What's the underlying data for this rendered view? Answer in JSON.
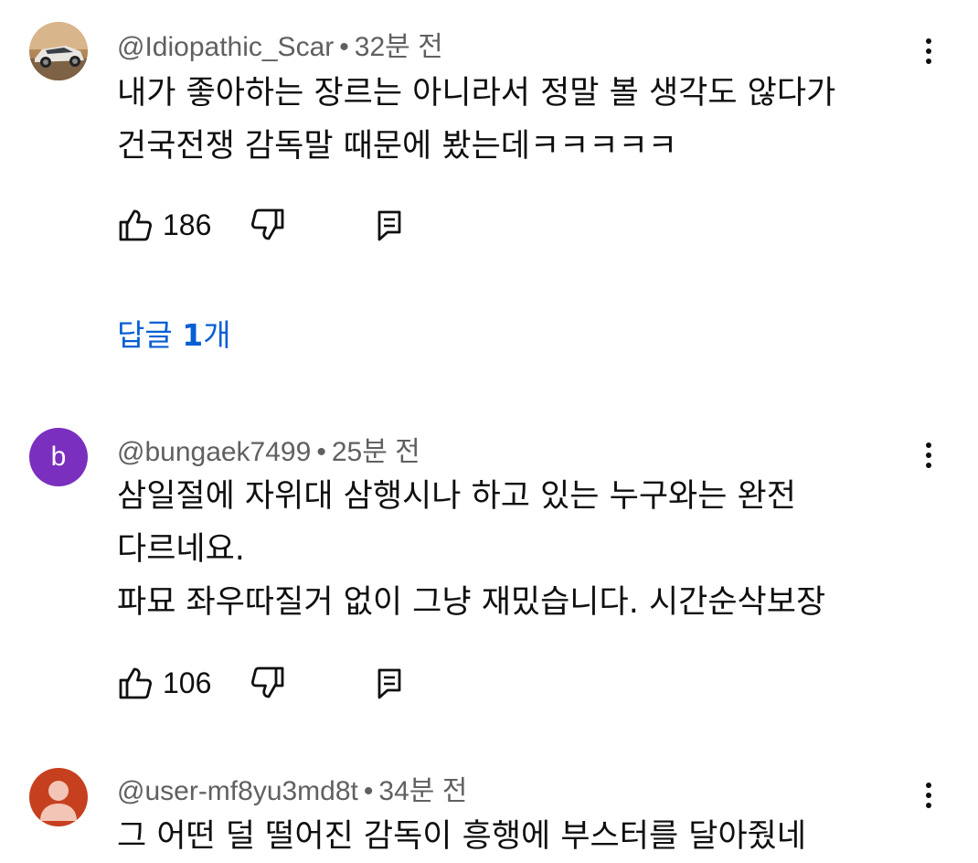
{
  "comments": [
    {
      "username": "@Idiopathic_Scar",
      "separator": "•",
      "time": "32분 전",
      "avatar": {
        "type": "photo"
      },
      "lines": [
        "내가 좋아하는 장르는 아니라서 정말 볼 생각도 않다가",
        "건국전쟁 감독말 때문에 봤는데ㅋㅋㅋㅋㅋ"
      ],
      "likes": "186",
      "replies_link": {
        "prefix": "답글 ",
        "count": "1",
        "suffix": "개"
      }
    },
    {
      "username": "@bungaek7499",
      "separator": "•",
      "time": "25분 전",
      "avatar": {
        "type": "letter",
        "letter": "b",
        "color": "#7b2fbf"
      },
      "lines": [
        "삼일절에 자위대 삼행시나 하고 있는 누구와는 완전",
        "다르네요.",
        "파묘 좌우따질거 없이 그냥 재밌습니다. 시간순삭보장"
      ],
      "likes": "106"
    },
    {
      "username": "@user-mf8yu3md8t",
      "separator": "•",
      "time": "34분 전",
      "avatar": {
        "type": "default-user",
        "color": "#c6401f"
      },
      "lines": [
        "그 어떤 덜 떨어진 감독이 흥행에 부스터를 달아줬네"
      ]
    }
  ],
  "colors": {
    "link": "#065fd4",
    "meta": "#606060",
    "text": "#0f0f0f"
  },
  "icons": [
    "like-icon",
    "dislike-icon",
    "reply-icon",
    "more-options-icon",
    "user-silhouette-icon"
  ]
}
